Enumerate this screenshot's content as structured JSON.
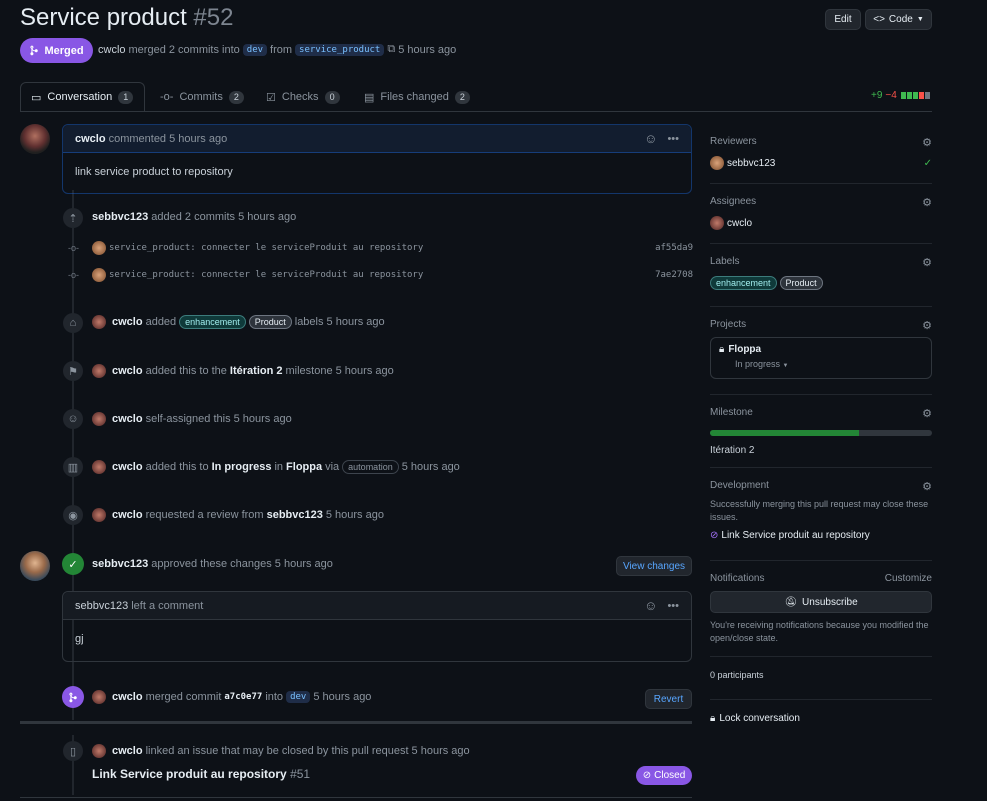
{
  "header": {
    "title": "Service product",
    "number": "#52",
    "edit_label": "Edit",
    "code_label": "Code",
    "status": "Merged",
    "author": "cwclo",
    "merge_text": "merged 2 commits into",
    "base_branch": "dev",
    "from_text": "from",
    "head_branch": "service_product",
    "time": "5 hours ago"
  },
  "tabs": [
    {
      "label": "Conversation",
      "count": "1"
    },
    {
      "label": "Commits",
      "count": "2"
    },
    {
      "label": "Checks",
      "count": "0"
    },
    {
      "label": "Files changed",
      "count": "2"
    }
  ],
  "diffstat": {
    "additions": "+9",
    "deletions": "−4"
  },
  "comment1": {
    "author": "cwclo",
    "action": "commented 5 hours ago",
    "body": "link service product to repository"
  },
  "commits_event": {
    "author": "sebbvc123",
    "text": "added 2 commits 5 hours ago"
  },
  "commits": [
    {
      "message": "service_product: connecter le serviceProduit au repository",
      "sha": "af55da9"
    },
    {
      "message": "service_product: connecter le serviceProduit au repository",
      "sha": "7ae2708"
    }
  ],
  "labels_event": {
    "author": "cwclo",
    "pre": "added",
    "label1": "enhancement",
    "label2": "Product",
    "post": "labels 5 hours ago"
  },
  "milestone_event": {
    "author": "cwclo",
    "pre": "added this to the",
    "milestone": "Itération 2",
    "post": "milestone 5 hours ago"
  },
  "assign_event": {
    "author": "cwclo",
    "text": "self-assigned this 5 hours ago"
  },
  "project_event": {
    "author": "cwclo",
    "pre": "added this to",
    "status": "In progress",
    "in": "in",
    "project": "Floppa",
    "via": "via",
    "tag": "automation",
    "post": "5 hours ago"
  },
  "review_request_event": {
    "author": "cwclo",
    "pre": "requested a review from",
    "reviewer": "sebbvc123",
    "post": "5 hours ago"
  },
  "approved_event": {
    "author": "sebbvc123",
    "text": "approved these changes 5 hours ago",
    "button": "View changes"
  },
  "comment2": {
    "author": "sebbvc123",
    "action": "left a comment",
    "body": "gj"
  },
  "merged_event": {
    "author": "cwclo",
    "pre": "merged commit",
    "sha": "a7c0e77",
    "into": "into",
    "branch": "dev",
    "post": "5 hours ago",
    "button": "Revert"
  },
  "linked_event": {
    "author": "cwclo",
    "text": "linked an issue that may be closed by this pull request 5 hours ago",
    "issue_title": "Link Service produit au repository",
    "issue_number": "#51",
    "issue_state": "Closed"
  },
  "sidebar": {
    "reviewers_title": "Reviewers",
    "reviewer": "sebbvc123",
    "assignees_title": "Assignees",
    "assignee": "cwclo",
    "labels_title": "Labels",
    "label1": "enhancement",
    "label2": "Product",
    "projects_title": "Projects",
    "project_name": "Floppa",
    "project_status": "In progress",
    "milestone_title": "Milestone",
    "milestone_name": "Itération 2",
    "milestone_progress": 0.67,
    "development_title": "Development",
    "development_text": "Successfully merging this pull request may close these issues.",
    "development_issue": "Link Service produit au repository",
    "notifications_title": "Notifications",
    "customize": "Customize",
    "unsubscribe": "Unsubscribe",
    "notifications_text": "You're receiving notifications because you modified the open/close state.",
    "participants": "0 participants",
    "lock": "Lock conversation"
  },
  "colors": {
    "merged": "#8957e5",
    "accent": "#2f81f7",
    "success": "#238636",
    "background": "#0d1117"
  }
}
